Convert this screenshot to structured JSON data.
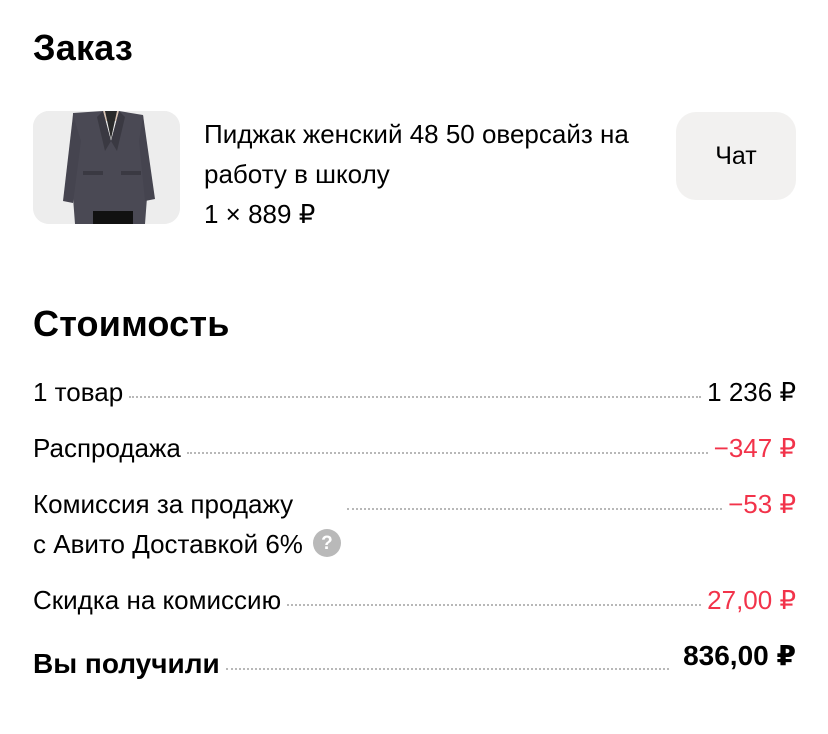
{
  "order": {
    "title": "Заказ",
    "product": {
      "name": "Пиджак женский 48 50 оверсайз на работу в школу",
      "quantity_price": "1 × 889 ₽",
      "image_icon": "jacket-photo"
    },
    "chat_label": "Чат"
  },
  "cost": {
    "title": "Стоимость",
    "rows": [
      {
        "label": "1 товар",
        "value": "1 236 ₽"
      },
      {
        "label": "Распродажа",
        "value": "−347 ₽"
      },
      {
        "label_line1": "Комиссия за продажу",
        "label_line2": "с Авито Доставкой 6%",
        "value": "−53 ₽",
        "help_icon": "?"
      },
      {
        "label": "Скидка на комиссию",
        "value": "27,00 ₽"
      }
    ],
    "total": {
      "label": "Вы получили",
      "value": "836,00 ₽"
    }
  },
  "colors": {
    "negative": "#f2334a",
    "chat_button_bg": "#f2f1f0",
    "help_icon_bg": "#b9b9b9"
  }
}
